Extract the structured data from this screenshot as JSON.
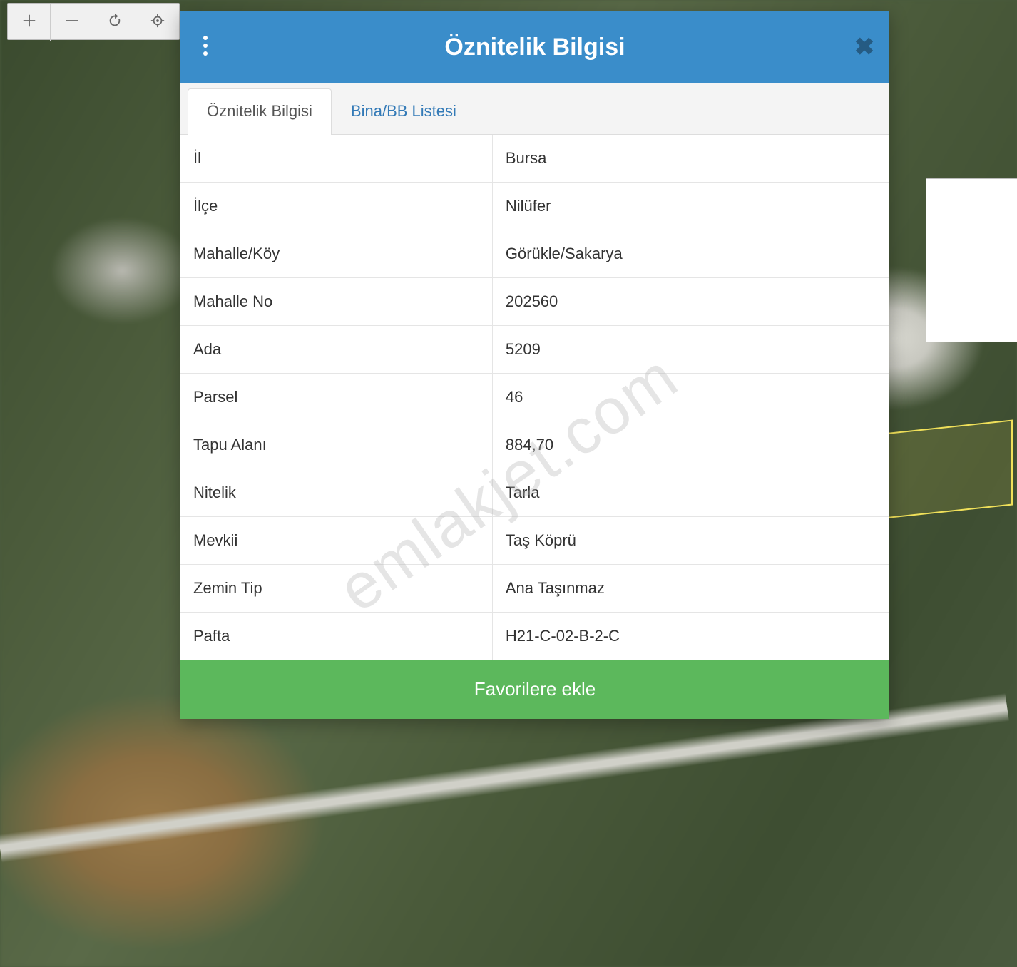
{
  "watermark": "emlakjet.com",
  "toolbar": {
    "zoom_in": "zoom-in",
    "zoom_out": "zoom-out",
    "refresh": "refresh",
    "locate": "locate"
  },
  "modal": {
    "title": "Öznitelik Bilgisi",
    "tabs": [
      {
        "label": "Öznitelik Bilgisi",
        "active": true
      },
      {
        "label": "Bina/BB Listesi",
        "active": false
      }
    ],
    "attributes": [
      {
        "key": "İl",
        "value": "Bursa"
      },
      {
        "key": "İlçe",
        "value": "Nilüfer"
      },
      {
        "key": "Mahalle/Köy",
        "value": "Görükle/Sakarya"
      },
      {
        "key": "Mahalle No",
        "value": "202560"
      },
      {
        "key": "Ada",
        "value": "5209"
      },
      {
        "key": "Parsel",
        "value": "46"
      },
      {
        "key": "Tapu Alanı",
        "value": "884,70"
      },
      {
        "key": "Nitelik",
        "value": "Tarla"
      },
      {
        "key": "Mevkii",
        "value": "Taş Köprü"
      },
      {
        "key": "Zemin Tip",
        "value": "Ana Taşınmaz"
      },
      {
        "key": "Pafta",
        "value": "H21-C-02-B-2-C"
      }
    ],
    "favorite_button": "Favorilere ekle"
  }
}
